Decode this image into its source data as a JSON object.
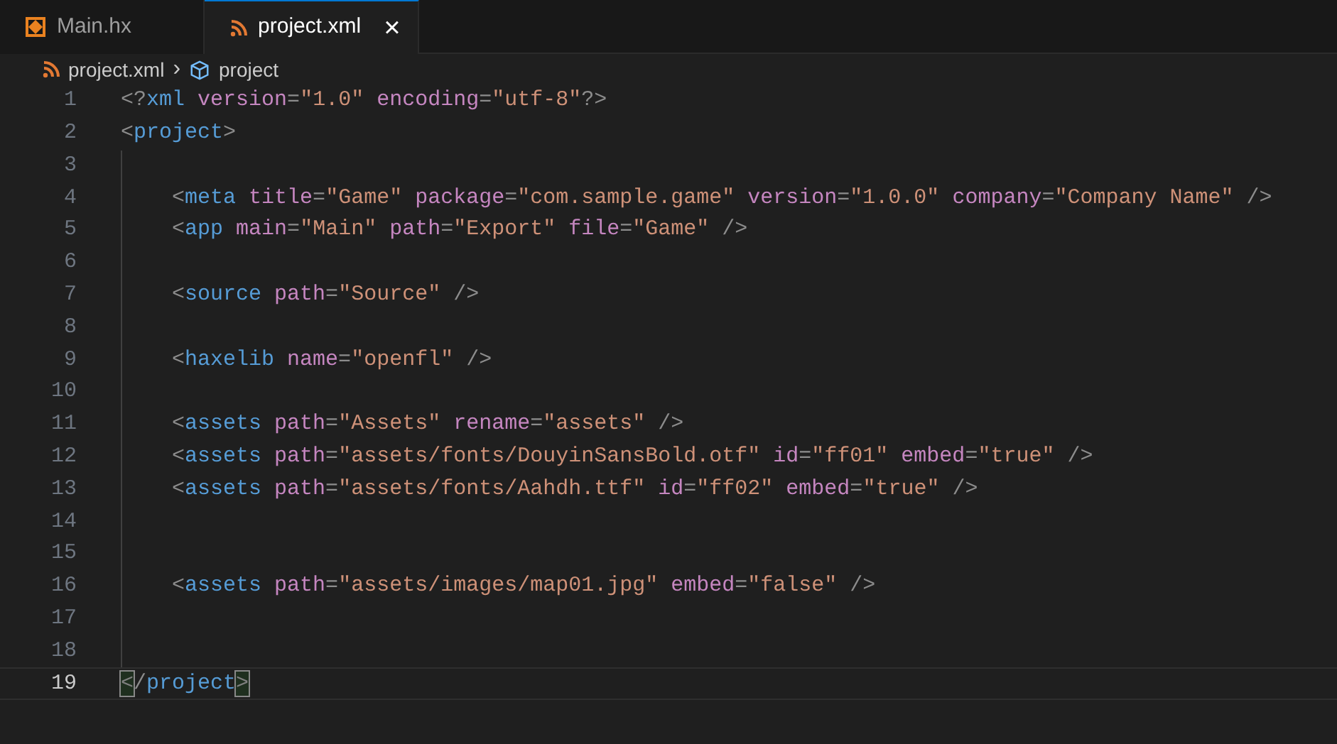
{
  "tabs": [
    {
      "label": "Main.hx",
      "kind": "haxe",
      "selected": false,
      "close": false
    },
    {
      "label": "project.xml",
      "kind": "xml",
      "selected": true,
      "close": true
    }
  ],
  "close_glyph": "×",
  "breadcrumb": [
    {
      "label": "project.xml",
      "kind": "xml"
    },
    {
      "label": "project",
      "kind": "element"
    }
  ],
  "breadcrumb_separator": "›",
  "lines": [
    {
      "number": "1",
      "current": false,
      "tokens": [
        {
          "kind": "punct",
          "text": "<?"
        },
        {
          "kind": "tag",
          "text": "xml"
        },
        {
          "kind": "attr",
          "text": " version"
        },
        {
          "kind": "punct",
          "text": "="
        },
        {
          "kind": "str",
          "text": "\"1.0\""
        },
        {
          "kind": "attr",
          "text": " encoding"
        },
        {
          "kind": "punct",
          "text": "="
        },
        {
          "kind": "str",
          "text": "\"utf-8\""
        },
        {
          "kind": "punct",
          "text": "?>"
        }
      ]
    },
    {
      "number": "2",
      "current": false,
      "tokens": [
        {
          "kind": "punct",
          "text": "<"
        },
        {
          "kind": "tag",
          "text": "project"
        },
        {
          "kind": "punct",
          "text": ">"
        }
      ]
    },
    {
      "number": "3",
      "current": false
    },
    {
      "number": "4",
      "current": false,
      "tokens": [
        {
          "kind": "punct",
          "text": "    <"
        },
        {
          "kind": "tag",
          "text": "meta"
        },
        {
          "kind": "attr",
          "text": " title"
        },
        {
          "kind": "punct",
          "text": "="
        },
        {
          "kind": "str",
          "text": "\"Game\""
        },
        {
          "kind": "attr",
          "text": " package"
        },
        {
          "kind": "punct",
          "text": "="
        },
        {
          "kind": "str",
          "text": "\"com.sample.game\""
        },
        {
          "kind": "attr",
          "text": " version"
        },
        {
          "kind": "punct",
          "text": "="
        },
        {
          "kind": "str",
          "text": "\"1.0.0\""
        },
        {
          "kind": "attr",
          "text": " company"
        },
        {
          "kind": "punct",
          "text": "="
        },
        {
          "kind": "str",
          "text": "\"Company Name\""
        },
        {
          "kind": "punct",
          "text": " />"
        }
      ]
    },
    {
      "number": "5",
      "current": false,
      "tokens": [
        {
          "kind": "punct",
          "text": "    <"
        },
        {
          "kind": "tag",
          "text": "app"
        },
        {
          "kind": "attr",
          "text": " main"
        },
        {
          "kind": "punct",
          "text": "="
        },
        {
          "kind": "str",
          "text": "\"Main\""
        },
        {
          "kind": "attr",
          "text": " path"
        },
        {
          "kind": "punct",
          "text": "="
        },
        {
          "kind": "str",
          "text": "\"Export\""
        },
        {
          "kind": "attr",
          "text": " file"
        },
        {
          "kind": "punct",
          "text": "="
        },
        {
          "kind": "str",
          "text": "\"Game\""
        },
        {
          "kind": "punct",
          "text": " />"
        }
      ]
    },
    {
      "number": "6",
      "current": false
    },
    {
      "number": "7",
      "current": false,
      "tokens": [
        {
          "kind": "punct",
          "text": "    <"
        },
        {
          "kind": "tag",
          "text": "source"
        },
        {
          "kind": "attr",
          "text": " path"
        },
        {
          "kind": "punct",
          "text": "="
        },
        {
          "kind": "str",
          "text": "\"Source\""
        },
        {
          "kind": "punct",
          "text": " />"
        }
      ]
    },
    {
      "number": "8",
      "current": false
    },
    {
      "number": "9",
      "current": false,
      "tokens": [
        {
          "kind": "punct",
          "text": "    <"
        },
        {
          "kind": "tag",
          "text": "haxelib"
        },
        {
          "kind": "attr",
          "text": " name"
        },
        {
          "kind": "punct",
          "text": "="
        },
        {
          "kind": "str",
          "text": "\"openfl\""
        },
        {
          "kind": "punct",
          "text": " />"
        }
      ]
    },
    {
      "number": "10",
      "current": false
    },
    {
      "number": "11",
      "current": false,
      "tokens": [
        {
          "kind": "punct",
          "text": "    <"
        },
        {
          "kind": "tag",
          "text": "assets"
        },
        {
          "kind": "attr",
          "text": " path"
        },
        {
          "kind": "punct",
          "text": "="
        },
        {
          "kind": "str",
          "text": "\"Assets\""
        },
        {
          "kind": "attr",
          "text": " rename"
        },
        {
          "kind": "punct",
          "text": "="
        },
        {
          "kind": "str",
          "text": "\"assets\""
        },
        {
          "kind": "punct",
          "text": " />"
        }
      ]
    },
    {
      "number": "12",
      "current": false,
      "tokens": [
        {
          "kind": "punct",
          "text": "    <"
        },
        {
          "kind": "tag",
          "text": "assets"
        },
        {
          "kind": "attr",
          "text": " path"
        },
        {
          "kind": "punct",
          "text": "="
        },
        {
          "kind": "str",
          "text": "\"assets/fonts/DouyinSansBold.otf\""
        },
        {
          "kind": "attr",
          "text": " id"
        },
        {
          "kind": "punct",
          "text": "="
        },
        {
          "kind": "str",
          "text": "\"ff01\""
        },
        {
          "kind": "attr",
          "text": " embed"
        },
        {
          "kind": "punct",
          "text": "="
        },
        {
          "kind": "str",
          "text": "\"true\""
        },
        {
          "kind": "punct",
          "text": " />"
        }
      ]
    },
    {
      "number": "13",
      "current": false,
      "tokens": [
        {
          "kind": "punct",
          "text": "    <"
        },
        {
          "kind": "tag",
          "text": "assets"
        },
        {
          "kind": "attr",
          "text": " path"
        },
        {
          "kind": "punct",
          "text": "="
        },
        {
          "kind": "str",
          "text": "\"assets/fonts/Aahdh.ttf\""
        },
        {
          "kind": "attr",
          "text": " id"
        },
        {
          "kind": "punct",
          "text": "="
        },
        {
          "kind": "str",
          "text": "\"ff02\""
        },
        {
          "kind": "attr",
          "text": " embed"
        },
        {
          "kind": "punct",
          "text": "="
        },
        {
          "kind": "str",
          "text": "\"true\""
        },
        {
          "kind": "punct",
          "text": " />"
        }
      ]
    },
    {
      "number": "14",
      "current": false
    },
    {
      "number": "15",
      "current": false
    },
    {
      "number": "16",
      "current": false,
      "tokens": [
        {
          "kind": "punct",
          "text": "    <"
        },
        {
          "kind": "tag",
          "text": "assets"
        },
        {
          "kind": "attr",
          "text": " path"
        },
        {
          "kind": "punct",
          "text": "="
        },
        {
          "kind": "str",
          "text": "\"assets/images/map01.jpg\""
        },
        {
          "kind": "attr",
          "text": " embed"
        },
        {
          "kind": "punct",
          "text": "="
        },
        {
          "kind": "str",
          "text": "\"false\""
        },
        {
          "kind": "punct",
          "text": " />"
        }
      ]
    },
    {
      "number": "17",
      "current": false
    },
    {
      "number": "18",
      "current": false
    },
    {
      "number": "19",
      "current": true,
      "tokens": [
        {
          "kind": "match",
          "text": "<"
        },
        {
          "kind": "punct",
          "text": "/"
        },
        {
          "kind": "tag",
          "text": "project"
        },
        {
          "kind": "match",
          "text": ">"
        }
      ]
    }
  ]
}
